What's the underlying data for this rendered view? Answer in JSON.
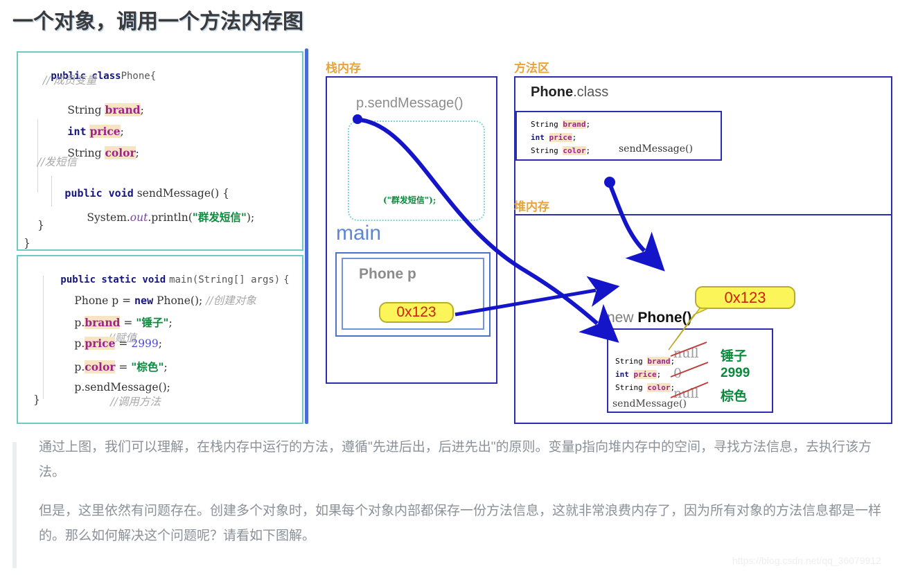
{
  "title": "一个对象，调用一个方法内存图",
  "code_blocks": {
    "class_block": {
      "l1_kw": "public class",
      "l1_name": "Phone",
      "l1_brace": "{",
      "l2_comment": "// 成员变量",
      "l3_type": "String",
      "l3_field": "brand",
      "l3_semi": ";",
      "l4_type": "int",
      "l4_field": "price",
      "l4_semi": ";",
      "l5_type": "String",
      "l5_field": "color",
      "l5_semi": ";",
      "l6_comment": "//发短信",
      "l7_kw": "public void",
      "l7_name": "sendMessage()",
      "l7_brace": "{",
      "l8_pre": "System.",
      "l8_out": "out",
      "l8_mid": ".println(",
      "l8_str": "\"群发短信\"",
      "l8_post": ");",
      "l9_brace": "}",
      "l10_brace": "}"
    },
    "main_block": {
      "l1_kw": "public static void",
      "l1_sig": "main(String[] args)",
      "l1_brace": "{",
      "l2_code": "Phone p = ",
      "l2_new": "new",
      "l2_call": " Phone();",
      "l2_comment": "//创建对象",
      "l3_obj": "p.",
      "l3_field": "brand",
      "l3_eq": " = ",
      "l3_val": "\"锤子\"",
      "l3_semi": ";",
      "l3_comment": "//赋值",
      "l4_obj": "p.",
      "l4_field": "price",
      "l4_eq": " = ",
      "l4_val": "2999",
      "l4_semi": ";",
      "l5_obj": "p.",
      "l5_field": "color",
      "l5_eq": " = ",
      "l5_val": "\"棕色\"",
      "l5_semi": ";",
      "l6_code": "p.sendMessage();",
      "l6_comment": "//调用方法",
      "l7_brace": "}"
    }
  },
  "memory": {
    "stack": {
      "label": "栈内存",
      "call_frame": "p.sendMessage()",
      "string_arg": "(\"群发短信\");",
      "main_label": "main",
      "variable_decl": "Phone  p",
      "address": "0x123"
    },
    "method_area": {
      "label": "方法区",
      "class_name_bold": "Phone",
      "class_name_suffix": ".class",
      "field_1_type": "String",
      "field_1_name": "brand",
      "field_2_type": "int",
      "field_2_name": "price",
      "field_3_type": "String",
      "field_3_name": "color",
      "method_name": "sendMessage()"
    },
    "heap": {
      "label": "堆内存",
      "object_prefix": "new ",
      "object_name": "Phone()",
      "address_callout": "0x123",
      "field_1_type": "String",
      "field_1_name": "brand",
      "field_1_default": "null",
      "field_1_value": "锤子",
      "field_2_type": "int",
      "field_2_name": "price",
      "field_2_default": "0",
      "field_2_value": "2999",
      "field_3_type": "String",
      "field_3_name": "color",
      "field_3_default": "null",
      "field_3_value": "棕色",
      "method_name": "sendMessage()"
    }
  },
  "prose": {
    "paragraph_1": "通过上图，我们可以理解，在栈内存中运行的方法，遵循\"先进后出，后进先出\"的原则。变量p指向堆内存中的空间，寻找方法信息，去执行该方法。",
    "paragraph_2": "但是，这里依然有问题存在。创建多个对象时，如果每个对象内部都保存一份方法信息，这就非常浪费内存了，因为所有对象的方法信息都是一样的。那么如何解决这个问题呢？请看如下图解。"
  },
  "watermark": "https://blog.csdn.net/qq_36079912",
  "colors": {
    "label_orange": "#e8a33a",
    "box_blue": "#2c2cae",
    "code_border_teal": "#6fc9c4",
    "arrow_blue": "#1414c8",
    "address_yellow": "#fbf55a",
    "address_red": "#cc2200",
    "value_green": "#0a8a3c",
    "field_highlight": "#f6e4c2"
  }
}
